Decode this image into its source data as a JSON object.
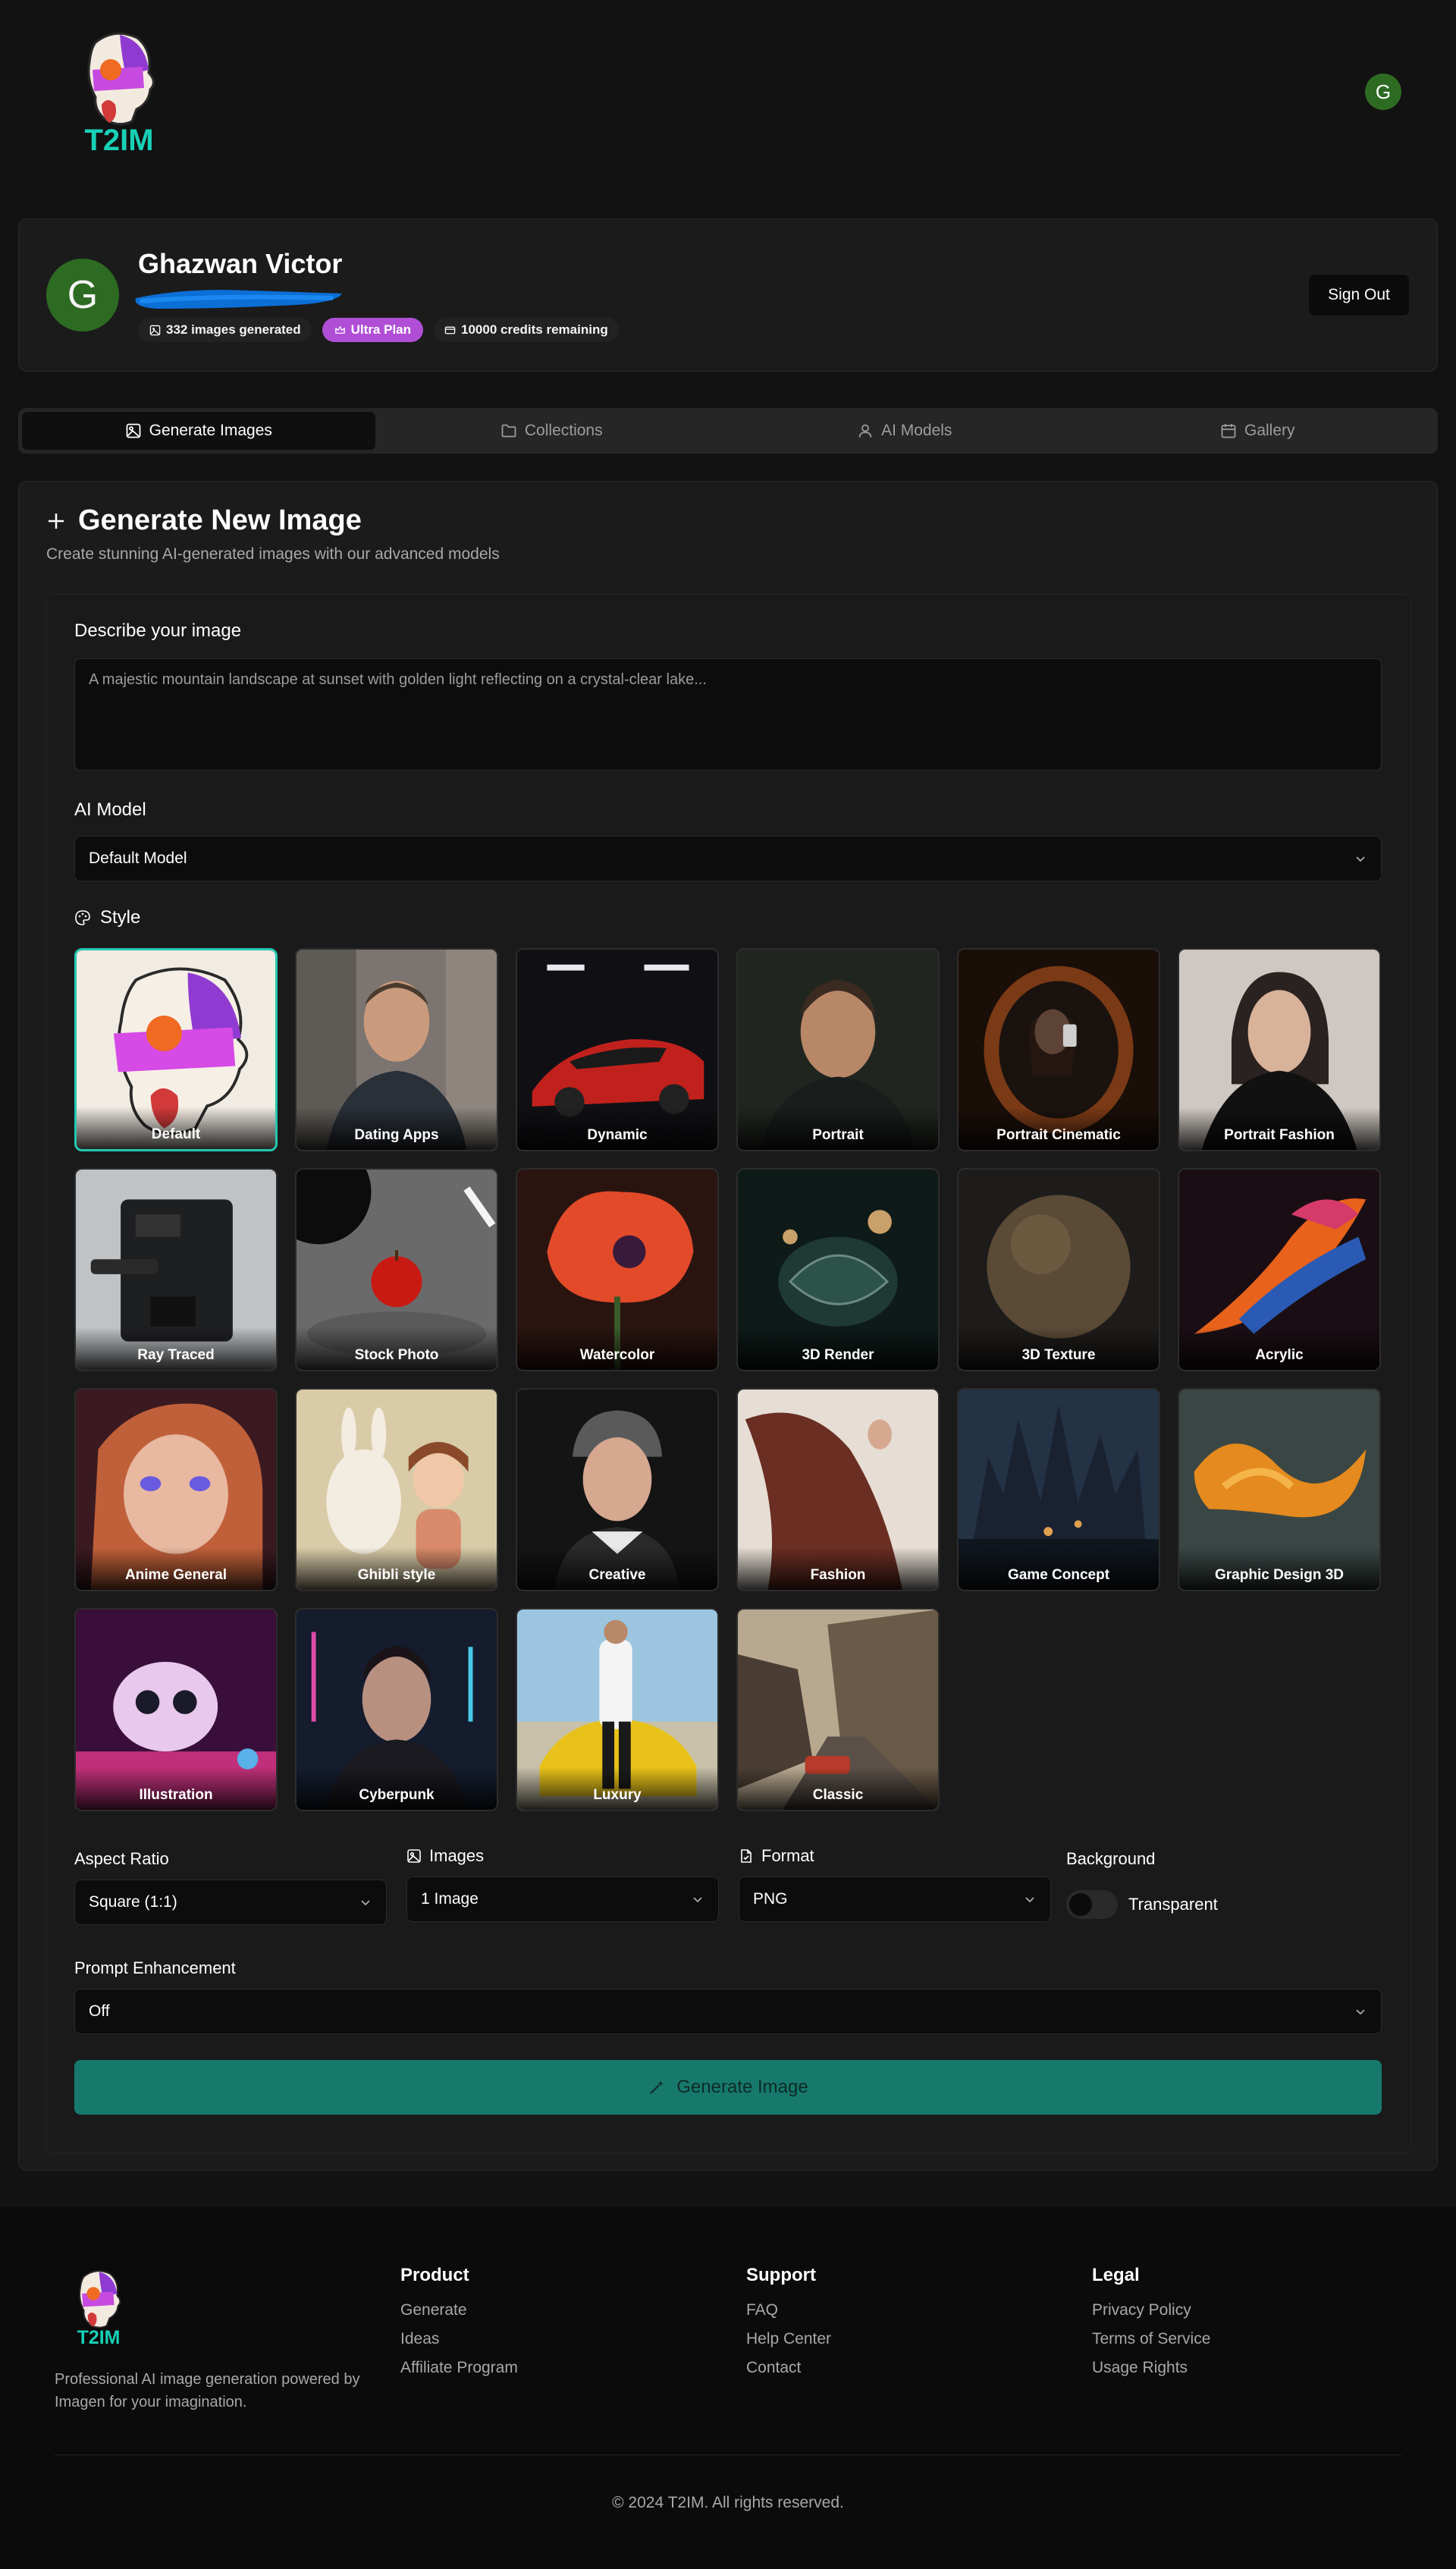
{
  "app": {
    "brand": "T2IM"
  },
  "header": {
    "user_initial": "G"
  },
  "profile": {
    "initial": "G",
    "name": "Ghazwan Victor",
    "images_generated": "332 images generated",
    "plan": "Ultra Plan",
    "credits": "10000 credits remaining",
    "sign_out": "Sign Out"
  },
  "tabs": [
    {
      "label": "Generate Images",
      "icon": "image-icon",
      "active": true
    },
    {
      "label": "Collections",
      "icon": "folder-icon",
      "active": false
    },
    {
      "label": "AI Models",
      "icon": "user-icon",
      "active": false
    },
    {
      "label": "Gallery",
      "icon": "calendar-icon",
      "active": false
    }
  ],
  "generate": {
    "title": "Generate New Image",
    "subtitle": "Create stunning AI-generated images with our advanced models",
    "prompt_label": "Describe your image",
    "prompt_placeholder": "A majestic mountain landscape at sunset with golden light reflecting on a crystal-clear lake...",
    "model_label": "AI Model",
    "model_value": "Default Model",
    "style_label": "Style",
    "styles": [
      "Default",
      "Dating Apps",
      "Dynamic",
      "Portrait",
      "Portrait Cinematic",
      "Portrait Fashion",
      "Ray Traced",
      "Stock Photo",
      "Watercolor",
      "3D Render",
      "3D Texture",
      "Acrylic",
      "Anime General",
      "Ghibli style",
      "Creative",
      "Fashion",
      "Game Concept",
      "Graphic Design 3D",
      "Illustration",
      "Cyberpunk",
      "Luxury",
      "Classic"
    ],
    "selected_style": "Default",
    "aspect_label": "Aspect Ratio",
    "aspect_value": "Square (1:1)",
    "images_label": "Images",
    "images_value": "1 Image",
    "format_label": "Format",
    "format_value": "PNG",
    "background_label": "Background",
    "transparent_label": "Transparent",
    "transparent_on": false,
    "enhance_label": "Prompt Enhancement",
    "enhance_value": "Off",
    "button": "Generate Image"
  },
  "footer": {
    "description": "Professional AI image generation powered by Imagen for your imagination.",
    "product": {
      "title": "Product",
      "links": [
        "Generate",
        "Ideas",
        "Affiliate Program"
      ]
    },
    "support": {
      "title": "Support",
      "links": [
        "FAQ",
        "Help Center",
        "Contact"
      ]
    },
    "legal": {
      "title": "Legal",
      "links": [
        "Privacy Policy",
        "Terms of Service",
        "Usage Rights"
      ]
    },
    "copyright": "© 2024 T2IM. All rights reserved."
  },
  "colors": {
    "accent": "#23c7b1",
    "button": "#16796c",
    "plan": "#b04fd6",
    "avatar": "#2e6b22"
  }
}
